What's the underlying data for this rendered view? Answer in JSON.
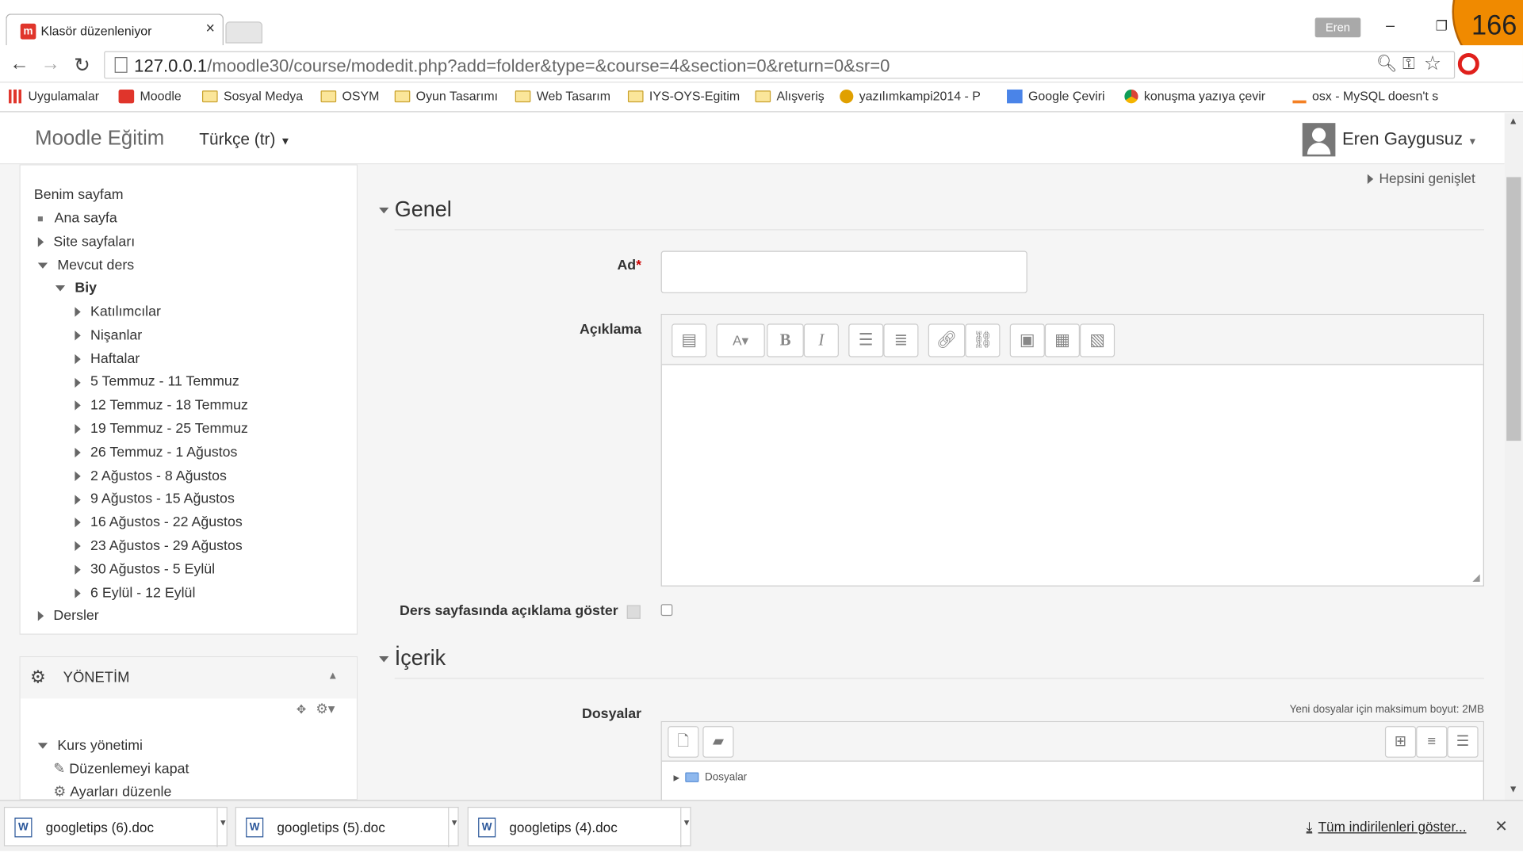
{
  "browser": {
    "tab_title": "Klasör düzenleniyor",
    "tab_close": "×",
    "profile": "Eren",
    "win_min": "–",
    "win_restore": "❐",
    "badge": "166",
    "url_host": "127.0.0.1",
    "url_path": "/moodle30/course/modedit.php?add=folder&type=&course=4&section=0&return=0&sr=0",
    "bookmarks": [
      "Uygulamalar",
      "Moodle",
      "Sosyal Medya",
      "OSYM",
      "Oyun Tasarımı",
      "Web Tasarım",
      "IYS-OYS-Egitim",
      "Alışveriş",
      "yazılımkampi2014 - P",
      "Google Çeviri",
      "konuşma yazıya çevir",
      "osx - MySQL doesn't s"
    ]
  },
  "navbar": {
    "brand": "Moodle Eğitim",
    "language": "Türkçe (tr)",
    "user": "Eren Gaygusuz"
  },
  "navigation": {
    "my_page": "Benim sayfam",
    "home": "Ana sayfa",
    "site_pages": "Site sayfaları",
    "current_course": "Mevcut ders",
    "course": "Biy",
    "course_items": [
      "Katılımcılar",
      "Nişanlar",
      "Haftalar",
      "5 Temmuz - 11 Temmuz",
      "12 Temmuz - 18 Temmuz",
      "19 Temmuz - 25 Temmuz",
      "26 Temmuz - 1 Ağustos",
      "2 Ağustos - 8 Ağustos",
      "9 Ağustos - 15 Ağustos",
      "16 Ağustos - 22 Ağustos",
      "23 Ağustos - 29 Ağustos",
      "30 Ağustos - 5 Eylül",
      "6 Eylül - 12 Eylül"
    ],
    "courses": "Dersler"
  },
  "admin": {
    "title": "YÖNETİM",
    "course_admin": "Kurs yönetimi",
    "turn_editing_off": "Düzenlemeyi kapat",
    "edit_settings": "Ayarları düzenle"
  },
  "form": {
    "expand_all": "Hepsini genişlet",
    "section_general": "Genel",
    "name_label": "Ad",
    "required_mark": "*",
    "name_value": "",
    "description_label": "Açıklama",
    "show_description_label": "Ders sayfasında açıklama göster",
    "show_description_checked": false,
    "section_content": "İçerik",
    "files_label": "Dosyalar",
    "max_size": "Yeni dosyalar için maksimum boyut: 2MB",
    "folder_name": "Dosyalar"
  },
  "downloads": {
    "items": [
      "googletips (6).doc",
      "googletips (5).doc",
      "googletips (4).doc"
    ],
    "show_all": "Tüm indirilenleri göster..."
  }
}
